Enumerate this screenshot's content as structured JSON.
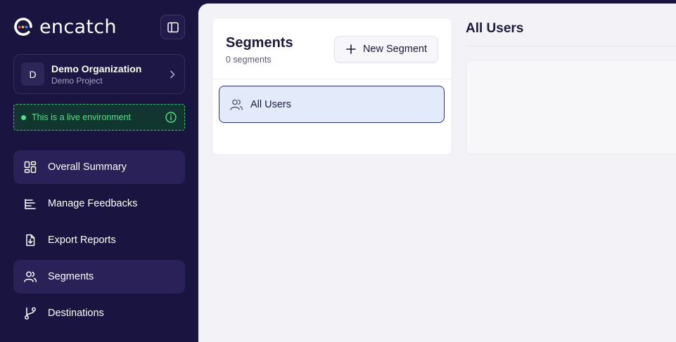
{
  "brand": {
    "name": "encatch",
    "logo_icon": "encatch-logo-icon",
    "dot_colors": [
      "#ef4a5b",
      "#f5b13d",
      "#3f8cf5"
    ]
  },
  "sidebar": {
    "collapse_icon": "sidebar-toggle-icon",
    "org": {
      "avatar": "D",
      "name": "Demo Organization",
      "project": "Demo Project",
      "icon": "chevron-right-icon"
    },
    "live_banner": {
      "text": "This is a live environment",
      "icon": "info-icon",
      "color": "#55e08d"
    },
    "nav": [
      {
        "label": "Overall Summary",
        "icon": "dashboard-grid-icon",
        "active": true
      },
      {
        "label": "Manage Feedbacks",
        "icon": "list-icon",
        "active": false
      },
      {
        "label": "Export Reports",
        "icon": "file-download-icon",
        "active": false
      },
      {
        "label": "Segments",
        "icon": "users-icon",
        "active": true
      },
      {
        "label": "Destinations",
        "icon": "git-branch-icon",
        "active": false
      }
    ]
  },
  "segments_panel": {
    "title": "Segments",
    "count": "0 segments",
    "new_button": {
      "label": "New Segment",
      "icon": "plus-icon"
    },
    "items": [
      {
        "label": "All Users",
        "icon": "users-icon",
        "selected": true
      }
    ]
  },
  "detail": {
    "title": "All Users"
  },
  "colors": {
    "sidebar_bg": "#1a1440",
    "main_bg": "#f3f3f7",
    "selected_bg": "#e3ebfb",
    "selected_border": "#2b3380",
    "live_green": "#4ee08a"
  }
}
